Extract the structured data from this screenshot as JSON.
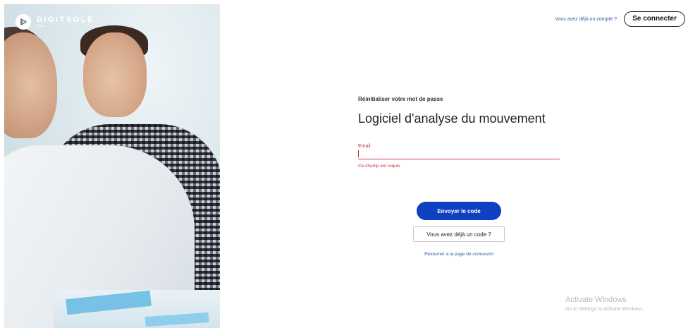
{
  "brand": {
    "name": "DIGITSOLE",
    "sub": "PRO",
    "logo_icon": "play-arrow-circle-icon"
  },
  "header": {
    "have_account_text": "Vous avez déjà un compte ?",
    "connect_label": "Se connecter"
  },
  "form": {
    "subtitle": "Réinitialiser votre mot de passe",
    "title": "Logiciel d'analyse du mouvement",
    "email_label": "Email",
    "email_value": "",
    "error_text": "Ce champ est requis",
    "send_label": "Envoyer le code",
    "have_code_label": "Vous avez déjà un code ?",
    "back_link": "Retourner à la page de connexion"
  },
  "watermark": {
    "title": "Activate Windows",
    "subtitle": "Go to Settings to activate Windows."
  },
  "colors": {
    "primary": "#1040c2",
    "error": "#c0303b",
    "link": "#2b5aa6"
  }
}
